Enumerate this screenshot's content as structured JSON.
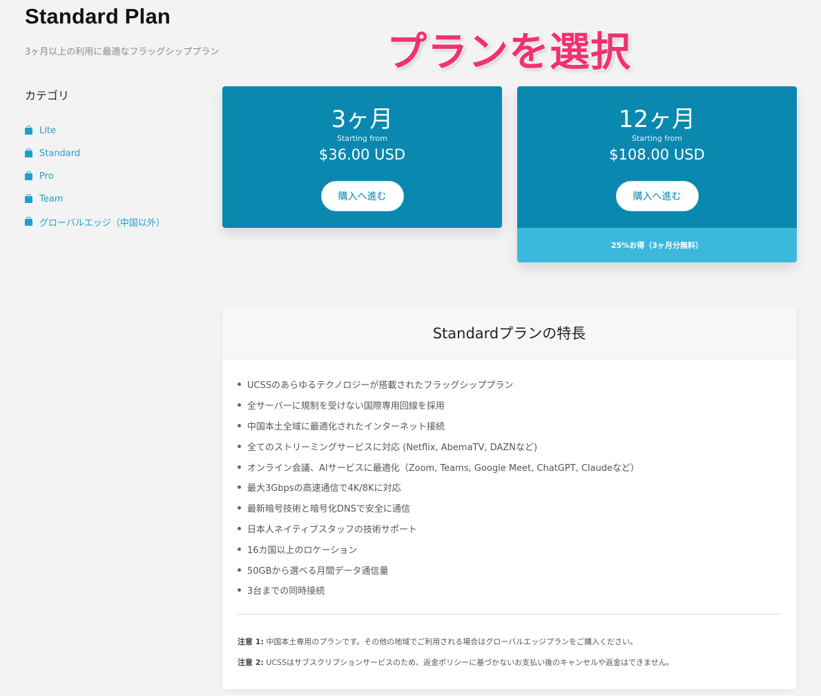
{
  "page": {
    "title": "Standard Plan",
    "subtitle": "3ヶ月以上の利用に最適なフラッグシッププラン"
  },
  "overlay_caption": "プランを選択",
  "sidebar": {
    "heading": "カテゴリ",
    "items": [
      {
        "label": "Lite",
        "icon": "shopping-bag-icon"
      },
      {
        "label": "Standard",
        "icon": "shopping-bag-icon"
      },
      {
        "label": "Pro",
        "icon": "shopping-bag-icon"
      },
      {
        "label": "Team",
        "icon": "shopping-bag-icon"
      },
      {
        "label": "グローバルエッジ（中国以外）",
        "icon": "shopping-bag-icon"
      }
    ]
  },
  "plans": [
    {
      "duration": "3ヶ月",
      "starting_label": "Starting from",
      "price": "$36.00 USD",
      "button_label": "購入へ進む"
    },
    {
      "duration": "12ヶ月",
      "starting_label": "Starting from",
      "price": "$108.00 USD",
      "button_label": "購入へ進む",
      "badge": "25%お得（3ヶ月分無料）"
    }
  ],
  "features": {
    "title": "Standardプランの特長",
    "items": [
      "UCSSのあらゆるテクノロジーが搭載されたフラッグシッププラン",
      "全サーバーに規制を受けない国際専用回線を採用",
      "中国本土全域に最適化されたインターネット接続",
      "全てのストリーミングサービスに対応 (Netflix, AbemaTV, DAZNなど)",
      "オンライン会議、AIサービスに最適化（Zoom, Teams, Google Meet, ChatGPT, Claudeなど）",
      "最大3Gbpsの高速通信で4K/8Kに対応",
      "最新暗号技術と暗号化DNSで安全に通信",
      "日本人ネイティブスタッフの技術サポート",
      "16カ国以上のロケーション",
      "50GBから選べる月間データ通信量",
      "3台までの同時接続"
    ],
    "notes": [
      {
        "label": "注意 1:",
        "text": "中国本土専用のプランです。その他の地域でご利用される場合はグローバルエッジプランをご購入ください。"
      },
      {
        "label": "注意 2:",
        "text": "UCSSはサブスクリプションサービスのため、返金ポリシーに基づかないお支払い後のキャンセルや返金はできません。"
      }
    ]
  },
  "colors": {
    "card_blue": "#0a88b0",
    "badge_blue": "#3bb8dc",
    "link_blue": "#1fa0c8",
    "caption_pink": "#f0326e"
  }
}
